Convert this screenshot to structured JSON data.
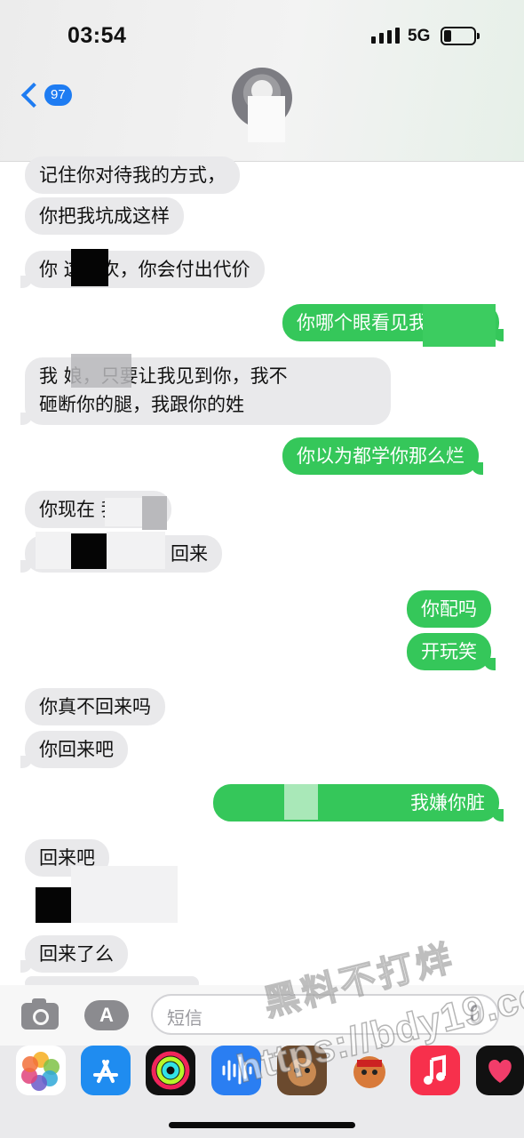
{
  "status_bar": {
    "time": "03:54",
    "network": "5G"
  },
  "nav": {
    "back_count": "97"
  },
  "messages": [
    {
      "dir": "in",
      "text": "记住你对待我的方式，"
    },
    {
      "dir": "in",
      "text": "你把我坑成这样"
    },
    {
      "dir": "in",
      "text": "你     这一次，你会付出代价"
    },
    {
      "dir": "out",
      "text": "你哪个眼看见我"
    },
    {
      "dir": "in",
      "text": "我        娘，只要让我见到你，我不"
    },
    {
      "dir": "in",
      "text": "砸断你的腿，我跟你的姓"
    },
    {
      "dir": "out",
      "text": "你以为都学你那么烂"
    },
    {
      "dir": "in",
      "text": "你现在       我问你"
    },
    {
      "dir": "in",
      "text": "回来"
    },
    {
      "dir": "out",
      "text": "你配吗"
    },
    {
      "dir": "out",
      "text": "开玩笑"
    },
    {
      "dir": "in",
      "text": "你真不回来吗"
    },
    {
      "dir": "in",
      "text": "你回来吧"
    },
    {
      "dir": "out",
      "text": "我嫌你脏"
    },
    {
      "dir": "in",
      "text": "回来吧"
    },
    {
      "dir": "in",
      "text": "回来了么"
    }
  ],
  "input": {
    "placeholder": "短信"
  },
  "dock": {
    "apps": [
      "photos-app",
      "app-store-app",
      "fitness-app",
      "voice-memos-app",
      "memoji-app",
      "memoji-app-2",
      "music-app",
      "health-app"
    ],
    "accent": "#35c75a"
  },
  "watermark": {
    "line1": "黑料不打烊",
    "line2": "https://bdy19.co"
  },
  "colors": {
    "incoming": "#e9e9eb",
    "outgoing": "#35c75a",
    "link": "#1e7cf2"
  }
}
